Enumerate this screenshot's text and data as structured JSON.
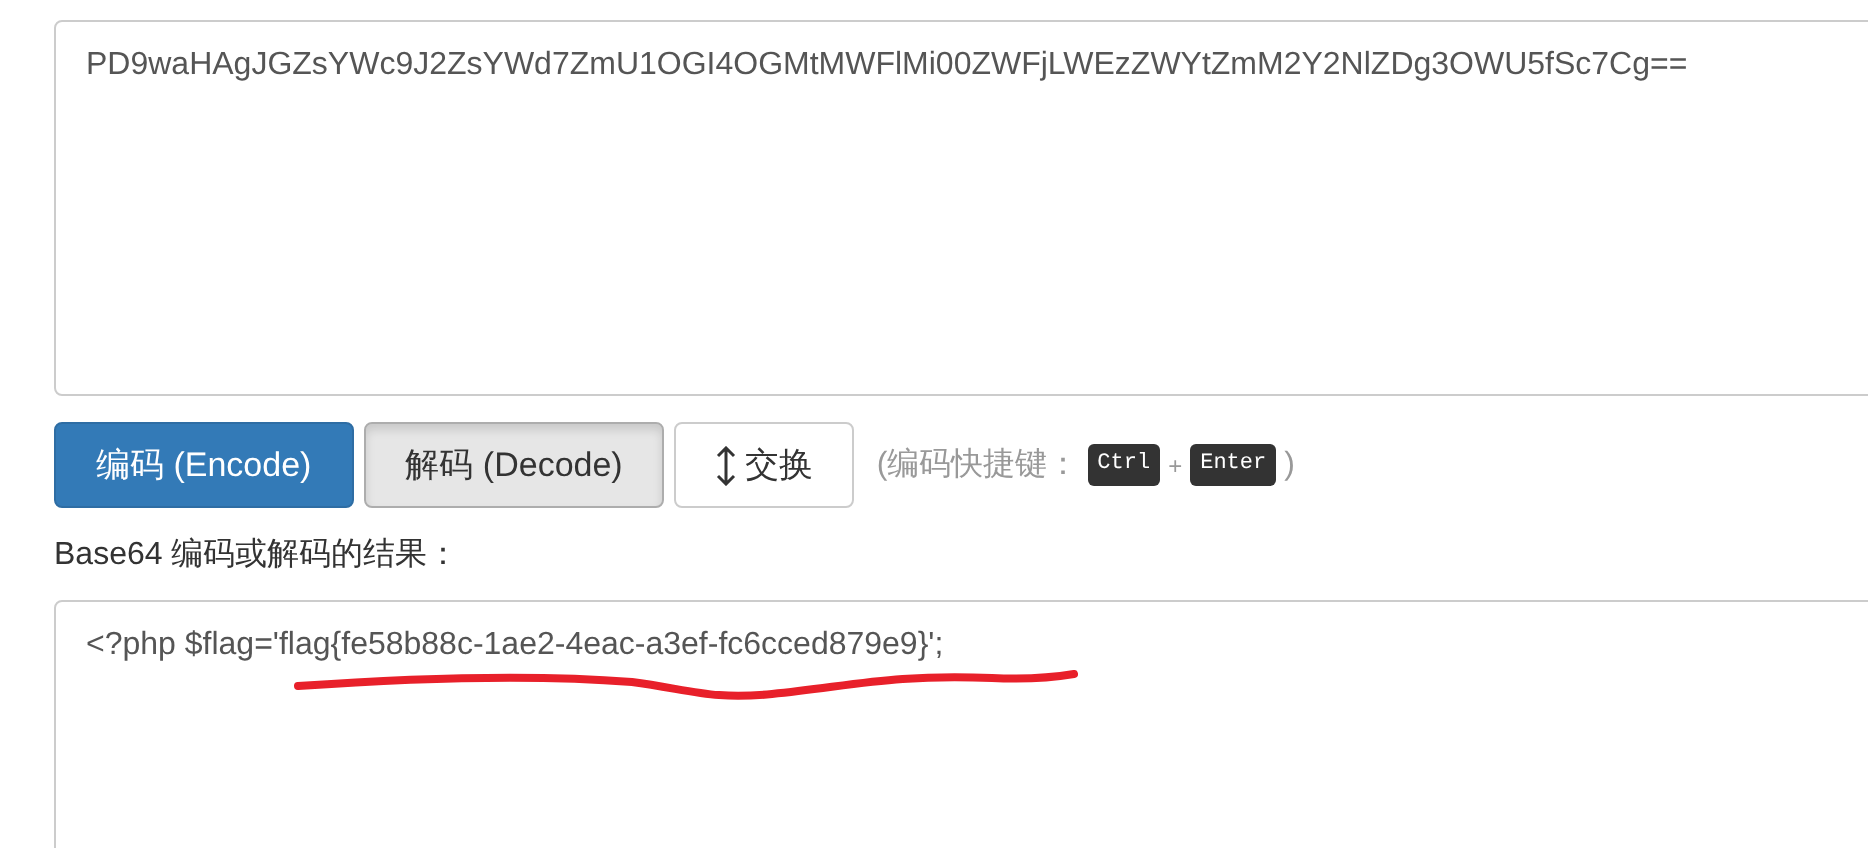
{
  "input": {
    "value": "PD9waHAgJGZsYWc9J2ZsYWd7ZmU1OGI4OGMtMWFlMi00ZWFjLWEzZWYtZmM2Y2NlZDg3OWU5fSc7Cg=="
  },
  "buttons": [
    {
      "label": "编码 (Encode)",
      "kind": "primary"
    },
    {
      "label": "解码 (Decode)",
      "kind": "pressed"
    },
    {
      "label": "交换",
      "kind": "swap"
    }
  ],
  "shortcut_hint": {
    "prefix": "(编码快捷键：",
    "keys": [
      "Ctrl",
      "Enter"
    ],
    "joiner": "+",
    "suffix": ")"
  },
  "result_label": "Base64 编码或解码的结果：",
  "output": {
    "value": "<?php $flag='flag{fe58b88c-1ae2-4eac-a3ef-fc6cced879e9}';",
    "underlined": true
  }
}
